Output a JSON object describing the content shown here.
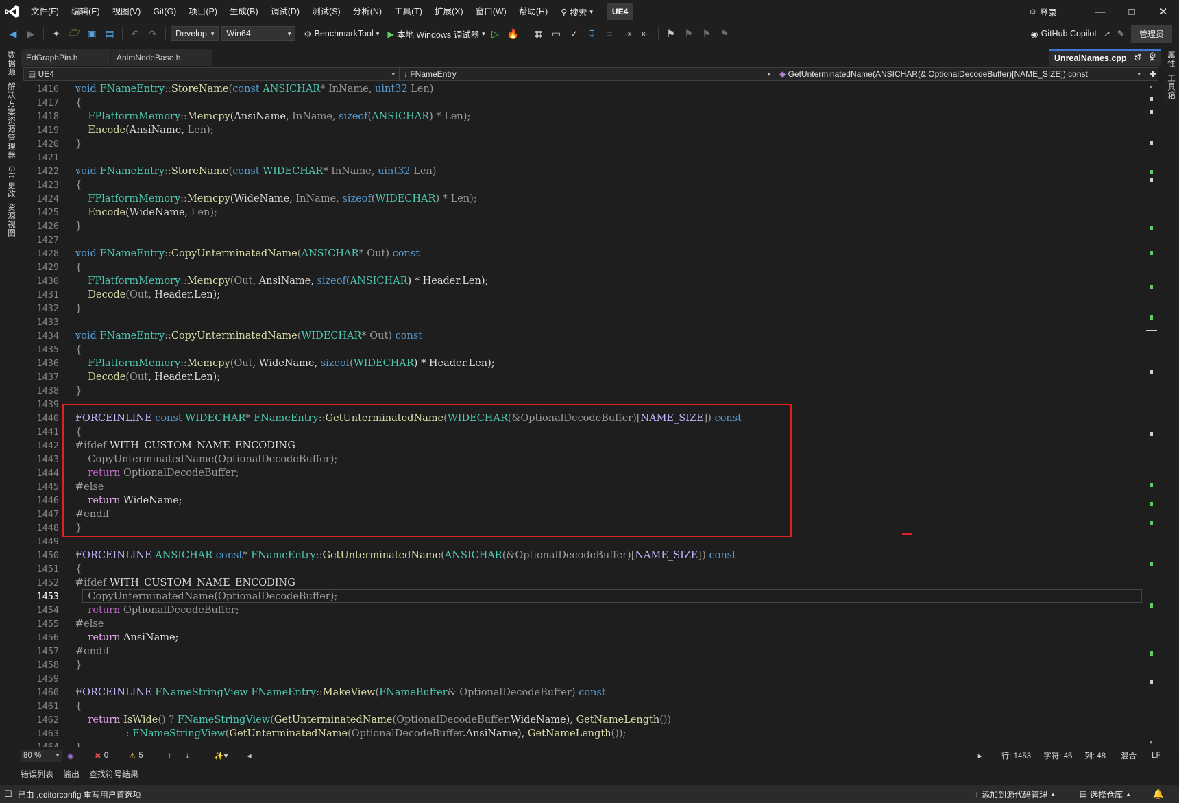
{
  "menu": {
    "items": [
      "文件(F)",
      "编辑(E)",
      "视图(V)",
      "Git(G)",
      "项目(P)",
      "生成(B)",
      "调试(D)",
      "测试(S)",
      "分析(N)",
      "工具(T)",
      "扩展(X)",
      "窗口(W)",
      "帮助(H)"
    ],
    "search": "搜索",
    "solution": "UE4",
    "login": "登录"
  },
  "toolbar": {
    "config": "Develop",
    "platform": "Win64",
    "startup": "BenchmarkTool",
    "debugger": "本地 Windows 调试器",
    "copilot": "GitHub Copilot",
    "admin": "管理员"
  },
  "side_tabs": {
    "left": [
      "数据源",
      "解决方案资源管理器",
      "Git 更改",
      "资源视图"
    ],
    "right": [
      "属性",
      "工具箱"
    ]
  },
  "tabs": {
    "inactive": [
      "EdGraphPin.h",
      "AnimNodeBase.h"
    ],
    "active": "UnrealNames.cpp"
  },
  "navbar": {
    "project": "UE4",
    "scope": "FNameEntry",
    "member": "GetUnterminatedName(ANSICHAR(& OptionalDecodeBuffer)[NAME_SIZE]) const"
  },
  "editor": {
    "current_line": 1453,
    "lines": [
      {
        "n": 1416,
        "fold": true,
        "t": [
          [
            "void ",
            "kw"
          ],
          [
            "FNameEntry",
            "ty"
          ],
          [
            "::",
            "dim"
          ],
          [
            "StoreName",
            "fn"
          ],
          [
            "(",
            "dim"
          ],
          [
            "const ",
            "kw"
          ],
          [
            "ANSICHAR",
            "ty"
          ],
          [
            "* ",
            "dim"
          ],
          [
            "InName",
            "prm"
          ],
          [
            ", ",
            "dim"
          ],
          [
            "uint32 ",
            "kw"
          ],
          [
            "Len",
            "prm"
          ],
          [
            ")",
            "dim"
          ]
        ]
      },
      {
        "n": 1417,
        "t": [
          [
            "{",
            "dim"
          ]
        ]
      },
      {
        "n": 1418,
        "t": [
          [
            "    FPlatformMemory",
            "ty"
          ],
          [
            "::",
            "dim"
          ],
          [
            "Memcpy",
            "fn"
          ],
          [
            "(AnsiName, ",
            "fld"
          ],
          [
            "InName",
            "prm"
          ],
          [
            ", ",
            "dim"
          ],
          [
            "sizeof",
            "kw"
          ],
          [
            "(",
            "dim"
          ],
          [
            "ANSICHAR",
            "ty"
          ],
          [
            ") * ",
            "dim"
          ],
          [
            "Len",
            "prm"
          ],
          [
            ");",
            "dim"
          ]
        ]
      },
      {
        "n": 1419,
        "t": [
          [
            "    Encode",
            "fn"
          ],
          [
            "(AnsiName, ",
            "fld"
          ],
          [
            "Len",
            "prm"
          ],
          [
            ");",
            "dim"
          ]
        ]
      },
      {
        "n": 1420,
        "t": [
          [
            "}",
            "dim"
          ]
        ]
      },
      {
        "n": 1421,
        "t": []
      },
      {
        "n": 1422,
        "fold": true,
        "t": [
          [
            "void ",
            "kw"
          ],
          [
            "FNameEntry",
            "ty"
          ],
          [
            "::",
            "dim"
          ],
          [
            "StoreName",
            "fn"
          ],
          [
            "(",
            "dim"
          ],
          [
            "const ",
            "kw"
          ],
          [
            "WIDECHAR",
            "ty"
          ],
          [
            "* ",
            "dim"
          ],
          [
            "InName",
            "prm"
          ],
          [
            ", ",
            "dim"
          ],
          [
            "uint32 ",
            "kw"
          ],
          [
            "Len",
            "prm"
          ],
          [
            ")",
            "dim"
          ]
        ]
      },
      {
        "n": 1423,
        "t": [
          [
            "{",
            "dim"
          ]
        ]
      },
      {
        "n": 1424,
        "t": [
          [
            "    FPlatformMemory",
            "ty"
          ],
          [
            "::",
            "dim"
          ],
          [
            "Memcpy",
            "fn"
          ],
          [
            "(WideName, ",
            "fld"
          ],
          [
            "InName",
            "prm"
          ],
          [
            ", ",
            "dim"
          ],
          [
            "sizeof",
            "kw"
          ],
          [
            "(",
            "dim"
          ],
          [
            "WIDECHAR",
            "ty"
          ],
          [
            ") * ",
            "dim"
          ],
          [
            "Len",
            "prm"
          ],
          [
            ");",
            "dim"
          ]
        ]
      },
      {
        "n": 1425,
        "t": [
          [
            "    Encode",
            "fn"
          ],
          [
            "(WideName, ",
            "fld"
          ],
          [
            "Len",
            "prm"
          ],
          [
            ");",
            "dim"
          ]
        ]
      },
      {
        "n": 1426,
        "t": [
          [
            "}",
            "dim"
          ]
        ]
      },
      {
        "n": 1427,
        "t": []
      },
      {
        "n": 1428,
        "fold": true,
        "t": [
          [
            "void ",
            "kw"
          ],
          [
            "FNameEntry",
            "ty"
          ],
          [
            "::",
            "dim"
          ],
          [
            "CopyUnterminatedName",
            "fn"
          ],
          [
            "(",
            "dim"
          ],
          [
            "ANSICHAR",
            "ty"
          ],
          [
            "* ",
            "dim"
          ],
          [
            "Out",
            "prm"
          ],
          [
            ") ",
            "dim"
          ],
          [
            "const",
            "kw"
          ]
        ]
      },
      {
        "n": 1429,
        "t": [
          [
            "{",
            "dim"
          ]
        ]
      },
      {
        "n": 1430,
        "t": [
          [
            "    FPlatformMemory",
            "ty"
          ],
          [
            "::",
            "dim"
          ],
          [
            "Memcpy",
            "fn"
          ],
          [
            "(",
            "dim"
          ],
          [
            "Out",
            "prm"
          ],
          [
            ", AnsiName, ",
            "fld"
          ],
          [
            "sizeof",
            "kw"
          ],
          [
            "(",
            "dim"
          ],
          [
            "ANSICHAR",
            "ty"
          ],
          [
            ") * Header.Len);",
            "fld"
          ]
        ]
      },
      {
        "n": 1431,
        "t": [
          [
            "    Decode",
            "fn"
          ],
          [
            "(",
            "dim"
          ],
          [
            "Out",
            "prm"
          ],
          [
            ", Header.Len);",
            "fld"
          ]
        ]
      },
      {
        "n": 1432,
        "t": [
          [
            "}",
            "dim"
          ]
        ]
      },
      {
        "n": 1433,
        "t": []
      },
      {
        "n": 1434,
        "fold": true,
        "t": [
          [
            "void ",
            "kw"
          ],
          [
            "FNameEntry",
            "ty"
          ],
          [
            "::",
            "dim"
          ],
          [
            "CopyUnterminatedName",
            "fn"
          ],
          [
            "(",
            "dim"
          ],
          [
            "WIDECHAR",
            "ty"
          ],
          [
            "* ",
            "dim"
          ],
          [
            "Out",
            "prm"
          ],
          [
            ") ",
            "dim"
          ],
          [
            "const",
            "kw"
          ]
        ]
      },
      {
        "n": 1435,
        "t": [
          [
            "{",
            "dim"
          ]
        ]
      },
      {
        "n": 1436,
        "t": [
          [
            "    FPlatformMemory",
            "ty"
          ],
          [
            "::",
            "dim"
          ],
          [
            "Memcpy",
            "fn"
          ],
          [
            "(",
            "dim"
          ],
          [
            "Out",
            "prm"
          ],
          [
            ", WideName, ",
            "fld"
          ],
          [
            "sizeof",
            "kw"
          ],
          [
            "(",
            "dim"
          ],
          [
            "WIDECHAR",
            "ty"
          ],
          [
            ") * Header.Len);",
            "fld"
          ]
        ]
      },
      {
        "n": 1437,
        "t": [
          [
            "    Decode",
            "fn"
          ],
          [
            "(",
            "dim"
          ],
          [
            "Out",
            "prm"
          ],
          [
            ", Header.Len);",
            "fld"
          ]
        ]
      },
      {
        "n": 1438,
        "t": [
          [
            "}",
            "dim"
          ]
        ]
      },
      {
        "n": 1439,
        "t": []
      },
      {
        "n": 1440,
        "fold": true,
        "t": [
          [
            "FORCEINLINE ",
            "mc"
          ],
          [
            "const ",
            "kw"
          ],
          [
            "WIDECHAR",
            "ty"
          ],
          [
            "* ",
            "dim"
          ],
          [
            "FNameEntry",
            "ty"
          ],
          [
            "::",
            "dim"
          ],
          [
            "GetUnterminatedName",
            "fn"
          ],
          [
            "(",
            "dim"
          ],
          [
            "WIDECHAR",
            "ty"
          ],
          [
            "(&",
            "dim"
          ],
          [
            "OptionalDecodeBuffer",
            "prm"
          ],
          [
            ")[",
            "dim"
          ],
          [
            "NAME_SIZE",
            "mc"
          ],
          [
            "]) ",
            "dim"
          ],
          [
            "const",
            "kw"
          ]
        ]
      },
      {
        "n": 1441,
        "t": [
          [
            "{",
            "dim"
          ]
        ]
      },
      {
        "n": 1442,
        "fold": true,
        "t": [
          [
            "#ifdef ",
            "pp"
          ],
          [
            "WITH_CUSTOM_NAME_ENCODING",
            "fld"
          ]
        ]
      },
      {
        "n": 1443,
        "t": [
          [
            "    CopyUnterminatedName",
            "pp"
          ],
          [
            "(OptionalDecodeBuffer);",
            "pp"
          ]
        ]
      },
      {
        "n": 1444,
        "t": [
          [
            "    return ",
            "ms"
          ],
          [
            "OptionalDecodeBuffer;",
            "pp"
          ]
        ]
      },
      {
        "n": 1445,
        "fold": true,
        "t": [
          [
            "#else",
            "pp"
          ]
        ]
      },
      {
        "n": 1446,
        "t": [
          [
            "    return ",
            "ctl"
          ],
          [
            "WideName;",
            "fld"
          ]
        ]
      },
      {
        "n": 1447,
        "t": [
          [
            "#endif",
            "pp"
          ]
        ]
      },
      {
        "n": 1448,
        "t": [
          [
            "}",
            "dim"
          ]
        ]
      },
      {
        "n": 1449,
        "t": []
      },
      {
        "n": 1450,
        "fold": true,
        "t": [
          [
            "FORCEINLINE ",
            "mc"
          ],
          [
            "ANSICHAR ",
            "ty"
          ],
          [
            "const",
            "kw"
          ],
          [
            "* ",
            "dim"
          ],
          [
            "FNameEntry",
            "ty"
          ],
          [
            "::",
            "dim"
          ],
          [
            "GetUnterminatedName",
            "fn"
          ],
          [
            "(",
            "dim"
          ],
          [
            "ANSICHAR",
            "ty"
          ],
          [
            "(&",
            "dim"
          ],
          [
            "OptionalDecodeBuffer",
            "prm"
          ],
          [
            ")[",
            "dim"
          ],
          [
            "NAME_SIZE",
            "mc"
          ],
          [
            "]) ",
            "dim"
          ],
          [
            "const",
            "kw"
          ]
        ]
      },
      {
        "n": 1451,
        "t": [
          [
            "{",
            "dim"
          ]
        ]
      },
      {
        "n": 1452,
        "fold": true,
        "t": [
          [
            "#ifdef ",
            "pp"
          ],
          [
            "WITH_CUSTOM_NAME_ENCODING",
            "fld"
          ]
        ]
      },
      {
        "n": 1453,
        "t": [
          [
            "    CopyUnterminatedName",
            "pp"
          ],
          [
            "(OptionalDecodeBuffer);",
            "pp"
          ]
        ]
      },
      {
        "n": 1454,
        "t": [
          [
            "    return ",
            "ms"
          ],
          [
            "OptionalDecodeBuffer;",
            "pp"
          ]
        ]
      },
      {
        "n": 1455,
        "fold": true,
        "t": [
          [
            "#else",
            "pp"
          ]
        ]
      },
      {
        "n": 1456,
        "t": [
          [
            "    return ",
            "ctl"
          ],
          [
            "AnsiName;",
            "fld"
          ]
        ]
      },
      {
        "n": 1457,
        "t": [
          [
            "#endif",
            "pp"
          ]
        ]
      },
      {
        "n": 1458,
        "t": [
          [
            "}",
            "dim"
          ]
        ]
      },
      {
        "n": 1459,
        "t": []
      },
      {
        "n": 1460,
        "fold": true,
        "t": [
          [
            "FORCEINLINE ",
            "mc"
          ],
          [
            "FNameStringView ",
            "ty"
          ],
          [
            "FNameEntry",
            "ty"
          ],
          [
            "::",
            "dim"
          ],
          [
            "MakeView",
            "fn"
          ],
          [
            "(",
            "dim"
          ],
          [
            "FNameBuffer",
            "ty"
          ],
          [
            "& ",
            "dim"
          ],
          [
            "OptionalDecodeBuffer",
            "prm"
          ],
          [
            ") ",
            "dim"
          ],
          [
            "const",
            "kw"
          ]
        ]
      },
      {
        "n": 1461,
        "t": [
          [
            "{",
            "dim"
          ]
        ]
      },
      {
        "n": 1462,
        "t": [
          [
            "    return ",
            "ctl"
          ],
          [
            "IsWide",
            "fn"
          ],
          [
            "() ? ",
            "dim"
          ],
          [
            "FNameStringView",
            "ty"
          ],
          [
            "(",
            "dim"
          ],
          [
            "GetUnterminatedName",
            "fn"
          ],
          [
            "(",
            "dim"
          ],
          [
            "OptionalDecodeBuffer",
            "prm"
          ],
          [
            ".WideName), ",
            "fld"
          ],
          [
            "GetNameLength",
            "fn"
          ],
          [
            "())",
            "dim"
          ]
        ]
      },
      {
        "n": 1463,
        "t": [
          [
            "                : ",
            "dim"
          ],
          [
            "FNameStringView",
            "ty"
          ],
          [
            "(",
            "dim"
          ],
          [
            "GetUnterminatedName",
            "fn"
          ],
          [
            "(",
            "dim"
          ],
          [
            "OptionalDecodeBuffer",
            "prm"
          ],
          [
            ".AnsiName), ",
            "fld"
          ],
          [
            "GetNameLength",
            "fn"
          ],
          [
            "());",
            "dim"
          ]
        ]
      },
      {
        "n": 1464,
        "t": [
          [
            "}",
            "dim"
          ]
        ]
      }
    ]
  },
  "editor_status": {
    "zoom": "80 %",
    "errors": "0",
    "warnings": "5",
    "line": "行: 1453",
    "char": "字符: 45",
    "col": "列: 48",
    "tabs": "混合",
    "eol": "LF"
  },
  "bottom_tabs": [
    "错误列表",
    "输出",
    "查找符号结果"
  ],
  "statusbar": {
    "message": "已由 .editorconfig 重写用户首选项",
    "add_source": "添加到源代码管理",
    "select_repo": "选择仓库"
  },
  "icons": {
    "logo": "visual-studio-logo",
    "search": "magnifier-icon",
    "run": "play-icon"
  }
}
